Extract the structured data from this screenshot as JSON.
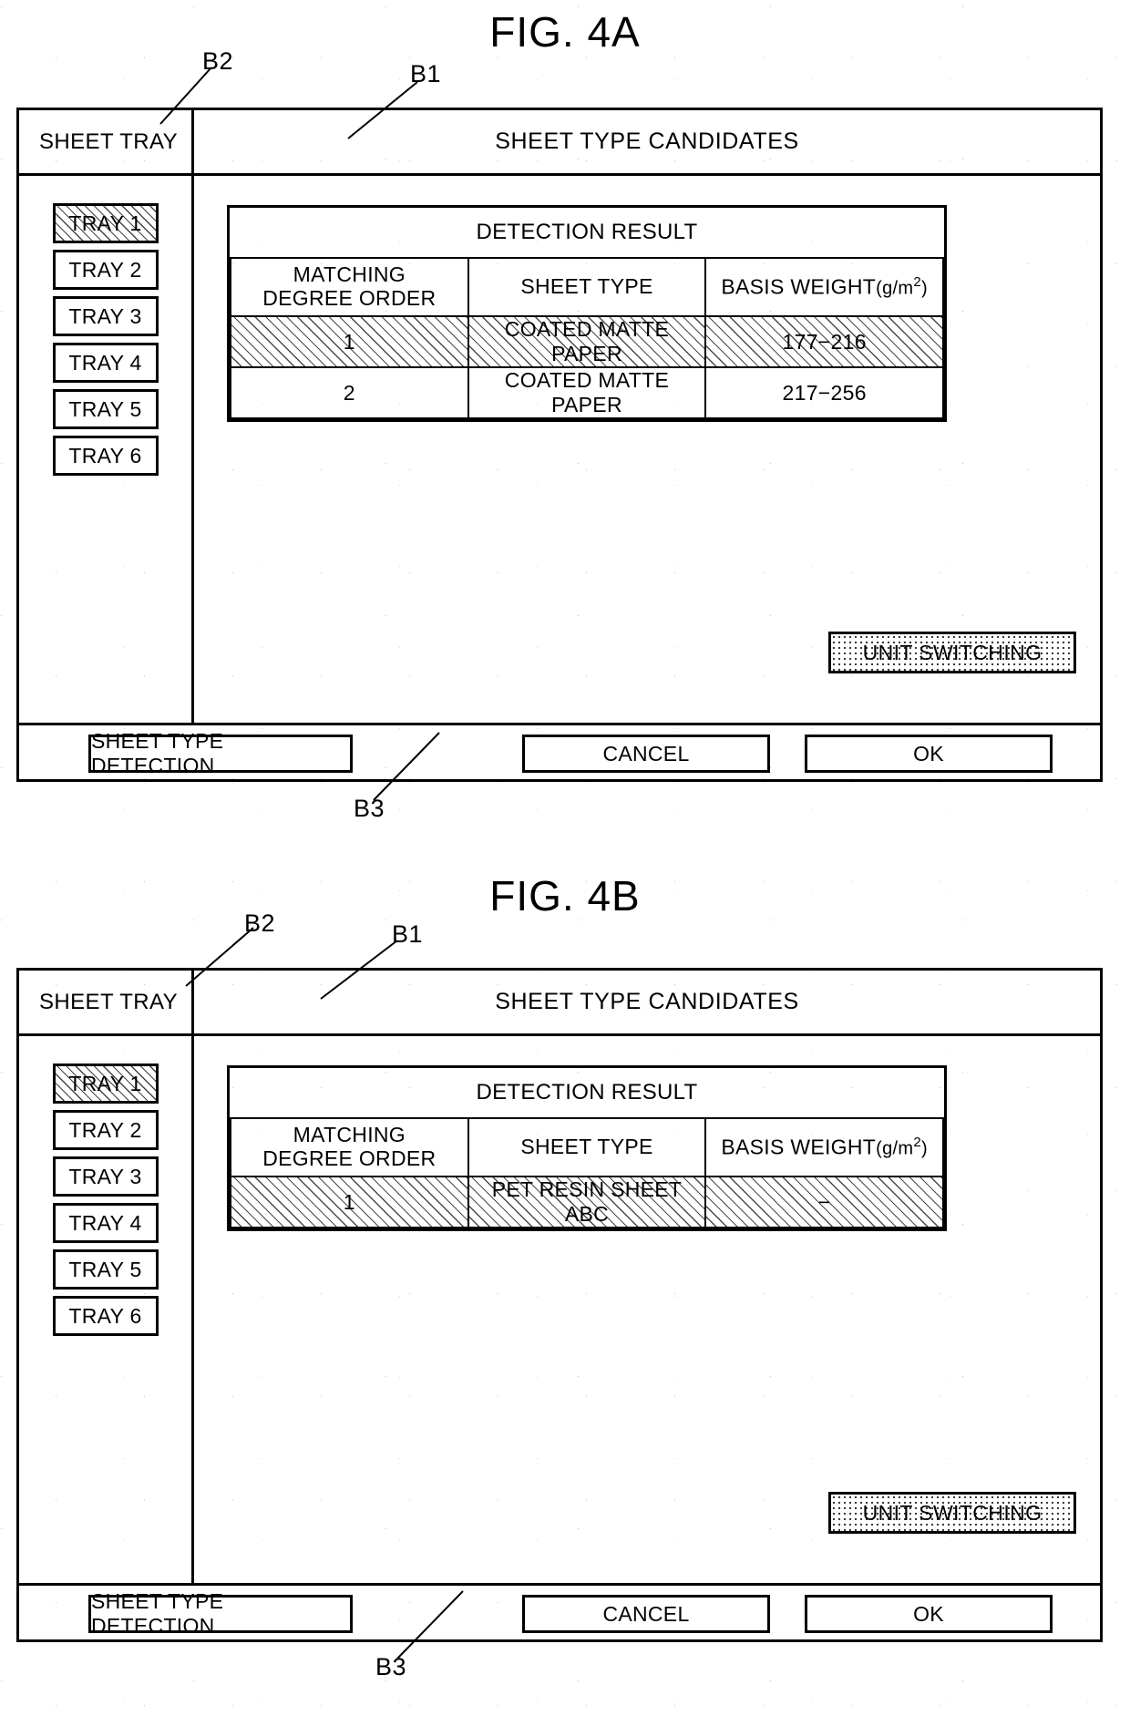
{
  "figures": [
    {
      "title": "FIG. 4A",
      "callouts": {
        "b1": "B1",
        "b2": "B2",
        "b3": "B3"
      },
      "header": {
        "tray_label": "SHEET TRAY",
        "candidates_label": "SHEET TYPE CANDIDATES"
      },
      "trays": [
        {
          "label": "TRAY 1",
          "selected": true
        },
        {
          "label": "TRAY 2",
          "selected": false
        },
        {
          "label": "TRAY 3",
          "selected": false
        },
        {
          "label": "TRAY 4",
          "selected": false
        },
        {
          "label": "TRAY 5",
          "selected": false
        },
        {
          "label": "TRAY 6",
          "selected": false
        }
      ],
      "table": {
        "title": "DETECTION RESULT",
        "columns": [
          "MATCHING DEGREE ORDER",
          "SHEET TYPE",
          "BASIS WEIGHT"
        ],
        "column_order_line1": "MATCHING",
        "column_order_line2": "DEGREE ORDER",
        "column_type": "SHEET TYPE",
        "column_weight_text": "BASIS WEIGHT",
        "column_weight_unit": "(g/m",
        "column_weight_unit_sup": "2",
        "column_weight_unit_close": ")",
        "rows": [
          {
            "order": "1",
            "sheet_type": "COATED MATTE PAPER",
            "basis_weight": "177−216",
            "highlighted": true
          },
          {
            "order": "2",
            "sheet_type": "COATED MATTE PAPER",
            "basis_weight": "217−256",
            "highlighted": false
          }
        ]
      },
      "unit_switch_label": "UNIT SWITCHING",
      "footer": {
        "detect_label": "SHEET TYPE DETECTION",
        "cancel_label": "CANCEL",
        "ok_label": "OK"
      }
    },
    {
      "title": "FIG. 4B",
      "callouts": {
        "b1": "B1",
        "b2": "B2",
        "b3": "B3"
      },
      "header": {
        "tray_label": "SHEET TRAY",
        "candidates_label": "SHEET TYPE CANDIDATES"
      },
      "trays": [
        {
          "label": "TRAY 1",
          "selected": true
        },
        {
          "label": "TRAY 2",
          "selected": false
        },
        {
          "label": "TRAY 3",
          "selected": false
        },
        {
          "label": "TRAY 4",
          "selected": false
        },
        {
          "label": "TRAY 5",
          "selected": false
        },
        {
          "label": "TRAY 6",
          "selected": false
        }
      ],
      "table": {
        "title": "DETECTION RESULT",
        "columns": [
          "MATCHING DEGREE ORDER",
          "SHEET TYPE",
          "BASIS WEIGHT"
        ],
        "column_order_line1": "MATCHING",
        "column_order_line2": "DEGREE ORDER",
        "column_type": "SHEET TYPE",
        "column_weight_text": "BASIS WEIGHT",
        "column_weight_unit": "(g/m",
        "column_weight_unit_sup": "2",
        "column_weight_unit_close": ")",
        "rows": [
          {
            "order": "1",
            "sheet_type": "PET RESIN SHEET ABC",
            "basis_weight": "−",
            "highlighted": true
          }
        ]
      },
      "unit_switch_label": "UNIT SWITCHING",
      "footer": {
        "detect_label": "SHEET TYPE DETECTION",
        "cancel_label": "CANCEL",
        "ok_label": "OK"
      }
    }
  ]
}
